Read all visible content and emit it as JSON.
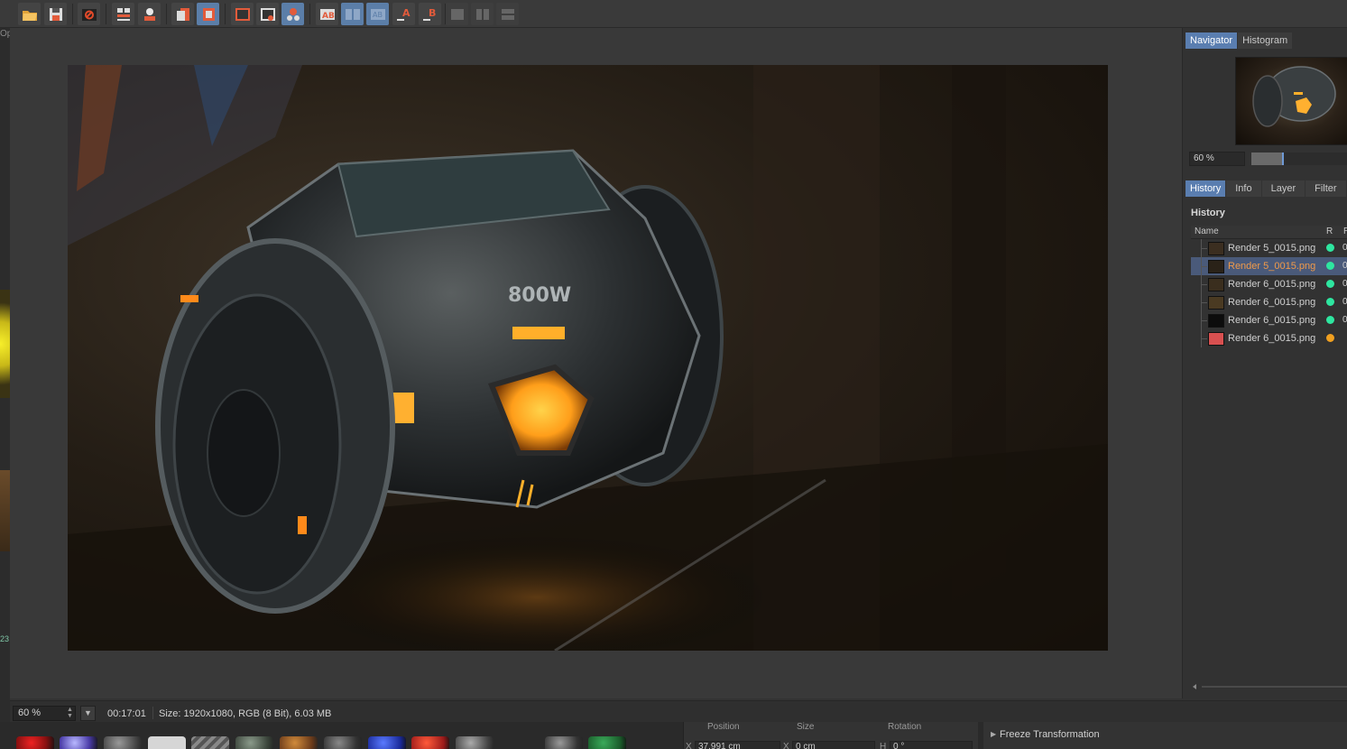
{
  "toolbar": {
    "buttons": [
      {
        "name": "open-icon"
      },
      {
        "name": "save-icon"
      },
      {
        "name": "render-settings-icon"
      },
      {
        "name": "layers-icon"
      },
      {
        "name": "user-icon"
      },
      {
        "name": "copy-icon"
      },
      {
        "name": "stop-icon"
      },
      {
        "name": "single-view-icon"
      },
      {
        "name": "view-lens-icon"
      },
      {
        "name": "view-compare-icon"
      },
      {
        "name": "ab-compare-icon"
      },
      {
        "name": "ab-split-icon"
      },
      {
        "name": "ab-swap-icon"
      },
      {
        "name": "set-a-icon"
      },
      {
        "name": "set-b-icon"
      },
      {
        "name": "grid-1-icon"
      },
      {
        "name": "grid-2-icon"
      },
      {
        "name": "grid-3-icon"
      }
    ]
  },
  "left_strip": {
    "opt_label": "Opt",
    "number": "23"
  },
  "navigator": {
    "tabs": [
      "Navigator",
      "Histogram"
    ],
    "active_tab": "Navigator",
    "zoom": "60 %",
    "slider_level": 0.33
  },
  "history_panel": {
    "tabs": [
      "History",
      "Info",
      "Layer",
      "Filter"
    ],
    "active_tab": "History",
    "title": "History",
    "columns": {
      "name": "Name",
      "r": "R",
      "r2": "R"
    },
    "rows": [
      {
        "name": "Render 5_0015.png",
        "status_color": "#2ee6a0",
        "trunc": "0",
        "selected": false
      },
      {
        "name": "Render 5_0015.png",
        "status_color": "#2ee6a0",
        "trunc": "0",
        "selected": true
      },
      {
        "name": "Render 6_0015.png",
        "status_color": "#2ee6a0",
        "trunc": "0",
        "selected": false
      },
      {
        "name": "Render 6_0015.png",
        "status_color": "#2ee6a0",
        "trunc": "0",
        "selected": false
      },
      {
        "name": "Render 6_0015.png",
        "status_color": "#2ee6a0",
        "trunc": "0",
        "selected": false
      },
      {
        "name": "Render 6_0015.png",
        "status_color": "#f0a020",
        "trunc": "",
        "selected": false
      }
    ]
  },
  "render_image": {
    "label": "800W"
  },
  "status_bar": {
    "zoom": "60 %",
    "time": "00:17:01",
    "size_info": "Size: 1920x1080, RGB (8 Bit), 6.03 MB"
  },
  "attributes": {
    "position_label": "Position",
    "size_label": "Size",
    "rotation_label": "Rotation",
    "x_label": "X",
    "x_value": "37.991 cm",
    "sx_label": "X",
    "sx_value": "0 cm",
    "h_label": "H",
    "h_value": "0 °"
  },
  "freeze": {
    "label": "Freeze Transformation"
  },
  "colors": {
    "accent": "#5a7eb0",
    "selection": "#4a5a7a",
    "selected_text": "#f09a4a"
  }
}
